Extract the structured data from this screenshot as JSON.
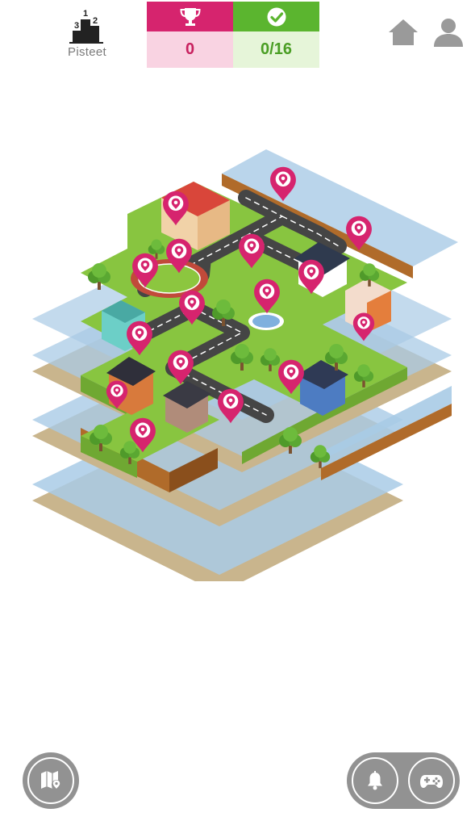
{
  "header": {
    "leaderboard_label": "Pisteet",
    "podium_ranks": [
      "1",
      "2",
      "3"
    ],
    "trophy_score": "0",
    "completed_progress": "0/16"
  },
  "icons": {
    "leaderboard": "podium-icon",
    "trophy": "trophy-icon",
    "check": "check-circle-icon",
    "home": "home-icon",
    "profile": "user-icon",
    "map": "map-pin-icon",
    "notifications": "bell-icon",
    "game": "gamepad-icon",
    "location": "location-pin-icon"
  },
  "colors": {
    "accent_pink": "#d6246e",
    "accent_green": "#5bb52f",
    "water": "#a9cbe6",
    "grass": "#8cc63f",
    "button_gray": "#929292"
  },
  "map": {
    "location_pins_count": 16
  }
}
